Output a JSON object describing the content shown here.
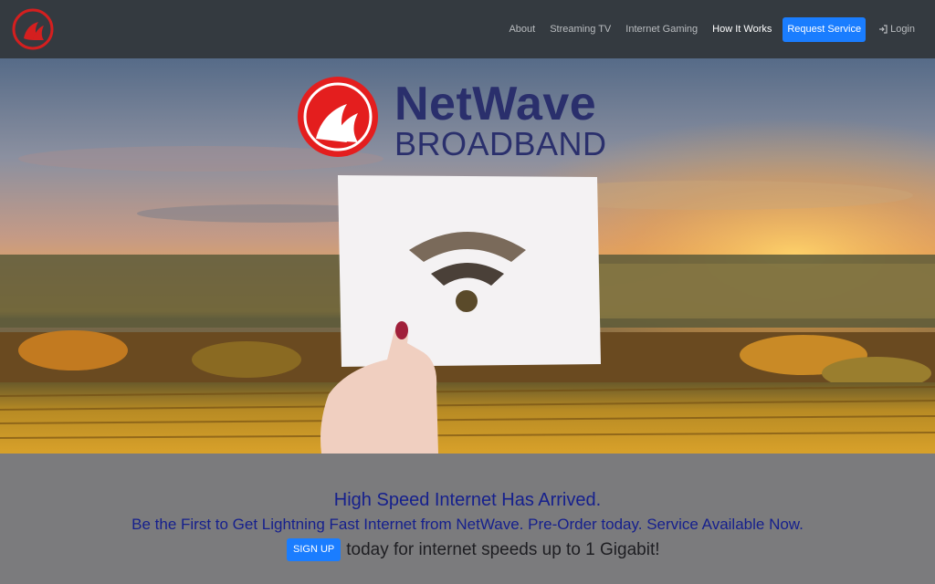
{
  "nav": {
    "links": [
      {
        "label": "About"
      },
      {
        "label": "Streaming TV"
      },
      {
        "label": "Internet Gaming"
      },
      {
        "label": "How It Works"
      }
    ],
    "request_service": "Request Service",
    "login": "Login"
  },
  "hero": {
    "brand_name": "NetWave",
    "brand_sub": "BROADBAND"
  },
  "content": {
    "headline": "High Speed Internet Has Arrived.",
    "subheadline": "Be the First to Get Lightning Fast Internet from NetWave. Pre-Order today. Service Available Now.",
    "signup_button": "SIGN UP",
    "cta_text": "today for internet speeds up to 1 Gigabit!"
  },
  "colors": {
    "navbar": "#343a40",
    "primary_button": "#1a7dff",
    "headline": "#16208d",
    "brand": "#2a2f6c",
    "logo_red": "#e41e1e",
    "page_bg": "#7b7b7d"
  },
  "icons": [
    "netwave-logo-icon",
    "login-icon",
    "wifi-icon"
  ]
}
